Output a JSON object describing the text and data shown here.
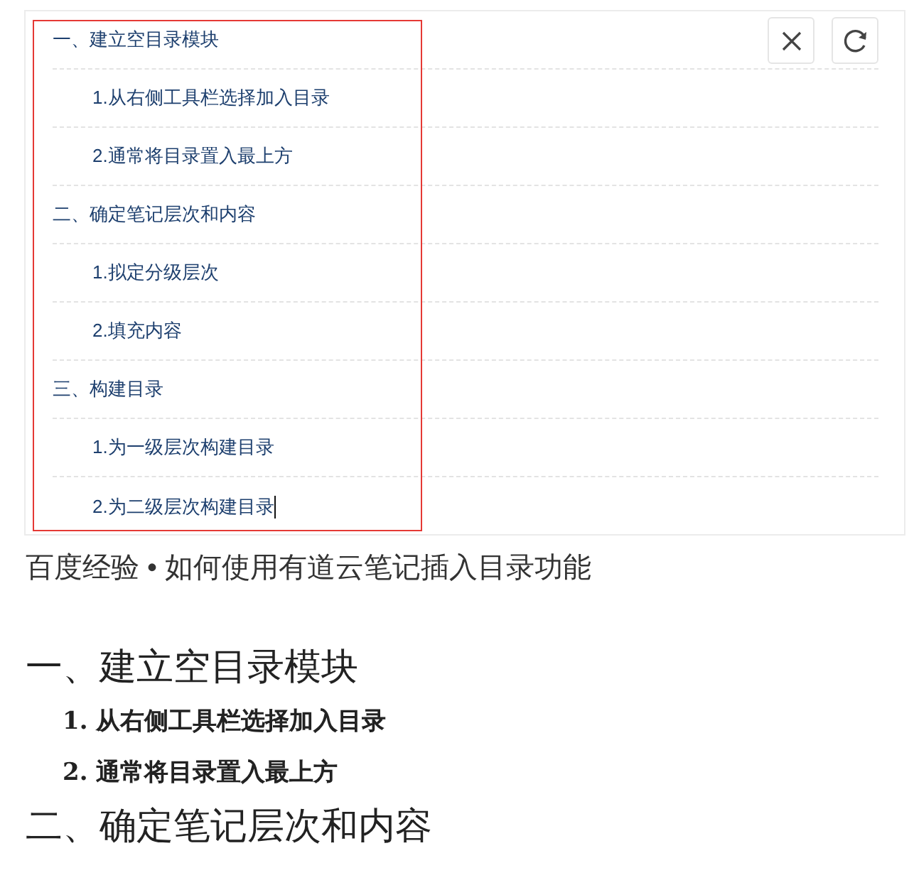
{
  "toc_panel": {
    "items": [
      {
        "text": "一、建立空目录模块",
        "children": [
          {
            "text": "1.从右侧工具栏选择加入目录"
          },
          {
            "text": "2.通常将目录置入最上方"
          }
        ]
      },
      {
        "text": "二、确定笔记层次和内容",
        "children": [
          {
            "text": "1.拟定分级层次"
          },
          {
            "text": "2.填充内容"
          }
        ]
      },
      {
        "text": "三、构建目录",
        "children": [
          {
            "text": "1.为一级层次构建目录"
          },
          {
            "text": "2.为二级层次构建目录"
          }
        ]
      }
    ]
  },
  "caption": "百度经验 • 如何使用有道云笔记插入目录功能",
  "document": {
    "sections": [
      {
        "heading": "一、建立空目录模块",
        "items": [
          "1. 从右侧工具栏选择加入目录",
          "2. 通常将目录置入最上方"
        ]
      },
      {
        "heading": "二、确定笔记层次和内容"
      }
    ]
  }
}
